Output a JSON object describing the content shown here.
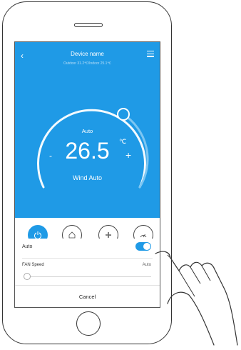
{
  "header": {
    "back_icon": "chevron-left-icon",
    "title": "Device name",
    "subtitle": "Outdoor 31.2℃/Indoor 25.1℃",
    "menu_icon": "menu-icon"
  },
  "dial": {
    "mode": "Auto",
    "temperature": "26.5",
    "unit": "℃",
    "minus": "-",
    "plus": "+",
    "wind": "Wind Auto"
  },
  "mode_buttons": [
    {
      "icon": "power-icon",
      "active": true
    },
    {
      "icon": "home-icon",
      "active": false
    },
    {
      "icon": "fan-icon",
      "active": false
    },
    {
      "icon": "speed-gauge-icon",
      "active": false
    }
  ],
  "panel": {
    "auto_label": "Auto",
    "auto_toggle_on": true,
    "fan_label": "FAN Speed",
    "fan_value": "Auto",
    "fan_level": 0,
    "cancel_label": "Cancel"
  },
  "colors": {
    "accent": "#1f9ae6"
  }
}
